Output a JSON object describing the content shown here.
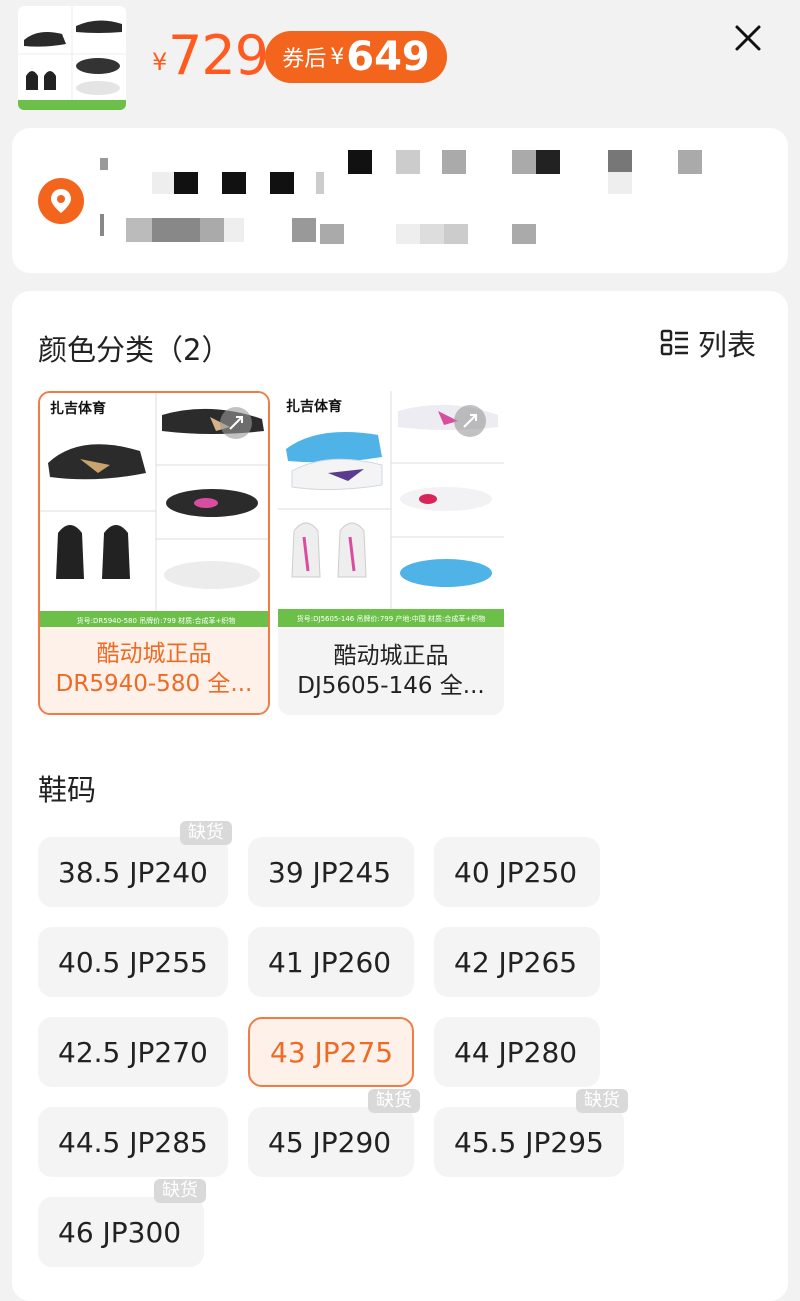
{
  "header": {
    "price_currency": "¥",
    "price": "729",
    "coupon_label": "券后",
    "coupon_currency": "¥",
    "coupon_price": "649",
    "accent_color": "#f3641c"
  },
  "address": {
    "icon": "location-pin-icon",
    "masked": true
  },
  "color_section": {
    "title": "颜色分类（2）",
    "list_toggle_label": "列表",
    "list_toggle_icon": "list-view-icon",
    "options": [
      {
        "line1": "酷动城正品",
        "line2": "DR5940-580 全...",
        "selected": true
      },
      {
        "line1": "酷动城正品",
        "line2": "DJ5605-146 全...",
        "selected": false
      }
    ]
  },
  "size_section": {
    "title": "鞋码",
    "out_of_stock_label": "缺货",
    "sizes": [
      {
        "label": "38.5 JP240",
        "out_of_stock": true
      },
      {
        "label": "39 JP245",
        "out_of_stock": false
      },
      {
        "label": "40 JP250",
        "out_of_stock": false
      },
      {
        "label": "40.5 JP255",
        "out_of_stock": false
      },
      {
        "label": "41 JP260",
        "out_of_stock": false
      },
      {
        "label": "42 JP265",
        "out_of_stock": false
      },
      {
        "label": "42.5 JP270",
        "out_of_stock": false
      },
      {
        "label": "43 JP275",
        "out_of_stock": false,
        "selected": true
      },
      {
        "label": "44 JP280",
        "out_of_stock": false
      },
      {
        "label": "44.5 JP285",
        "out_of_stock": false
      },
      {
        "label": "45 JP290",
        "out_of_stock": true
      },
      {
        "label": "45.5 JP295",
        "out_of_stock": true
      },
      {
        "label": "46 JP300",
        "out_of_stock": true
      }
    ]
  }
}
